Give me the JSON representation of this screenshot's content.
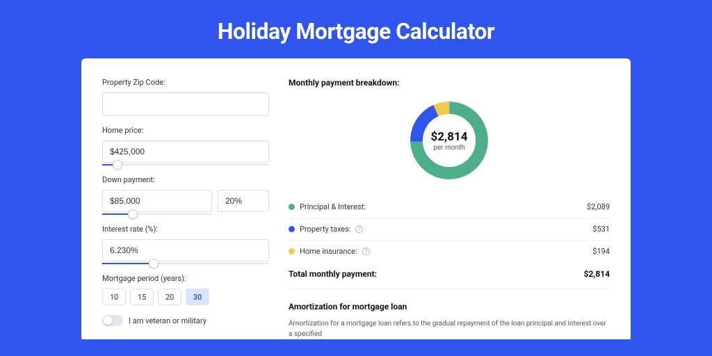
{
  "title": "Holiday Mortgage Calculator",
  "form": {
    "zip_label": "Property Zip Code:",
    "zip_value": "",
    "home_price_label": "Home price:",
    "home_price_value": "$425,000",
    "down_payment_label": "Down payment:",
    "down_payment_value": "$85,000",
    "down_payment_pct": "20%",
    "interest_label": "Interest rate (%):",
    "interest_value": "6.230%",
    "period_label": "Mortgage period (years):",
    "period_options": [
      "10",
      "15",
      "20",
      "30"
    ],
    "period_selected": "30",
    "veteran_label": "I am veteran or military",
    "veteran_on": false
  },
  "breakdown": {
    "title": "Monthly payment breakdown:",
    "center_value": "$2,814",
    "center_sub": "per month",
    "items": [
      {
        "label": "Principal & Interest:",
        "amount": "$2,089",
        "color": "green",
        "info": false
      },
      {
        "label": "Property taxes:",
        "amount": "$531",
        "color": "blue",
        "info": true
      },
      {
        "label": "Home insurance:",
        "amount": "$194",
        "color": "yellow",
        "info": true
      }
    ],
    "total_label": "Total monthly payment:",
    "total_value": "$2,814"
  },
  "amortization": {
    "title": "Amortization for mortgage loan",
    "text": "Amortization for a mortgage loan refers to the gradual repayment of the loan principal and interest over a specified"
  },
  "chart_data": {
    "type": "pie",
    "title": "Monthly payment breakdown",
    "series": [
      {
        "name": "Principal & Interest",
        "value": 2089,
        "color": "#4caf87"
      },
      {
        "name": "Property taxes",
        "value": 531,
        "color": "#2f55ed"
      },
      {
        "name": "Home insurance",
        "value": 194,
        "color": "#f2c94c"
      }
    ],
    "total": 2814,
    "center_label": "$2,814 per month"
  }
}
